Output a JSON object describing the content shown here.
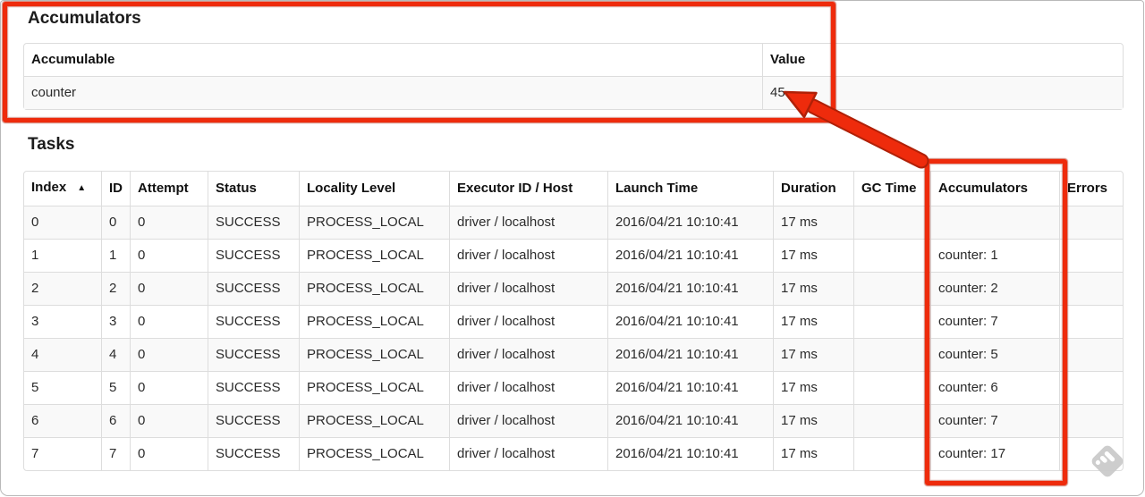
{
  "accumulators_section": {
    "heading": "Accumulators",
    "table": {
      "headers": {
        "accumulable": "Accumulable",
        "value": "Value"
      },
      "rows": [
        {
          "accumulable": "counter",
          "value": "45"
        }
      ]
    }
  },
  "tasks_section": {
    "heading": "Tasks",
    "table": {
      "headers": {
        "index": "Index",
        "id": "ID",
        "attempt": "Attempt",
        "status": "Status",
        "locality": "Locality Level",
        "executor": "Executor ID / Host",
        "launch": "Launch Time",
        "duration": "Duration",
        "gc": "GC Time",
        "accumulators": "Accumulators",
        "errors": "Errors"
      },
      "sort_icon": "▲",
      "rows": [
        {
          "index": "0",
          "id": "0",
          "attempt": "0",
          "status": "SUCCESS",
          "locality": "PROCESS_LOCAL",
          "executor": "driver / localhost",
          "launch": "2016/04/21 10:10:41",
          "duration": "17 ms",
          "gc": "",
          "accumulators": "",
          "errors": ""
        },
        {
          "index": "1",
          "id": "1",
          "attempt": "0",
          "status": "SUCCESS",
          "locality": "PROCESS_LOCAL",
          "executor": "driver / localhost",
          "launch": "2016/04/21 10:10:41",
          "duration": "17 ms",
          "gc": "",
          "accumulators": "counter: 1",
          "errors": ""
        },
        {
          "index": "2",
          "id": "2",
          "attempt": "0",
          "status": "SUCCESS",
          "locality": "PROCESS_LOCAL",
          "executor": "driver / localhost",
          "launch": "2016/04/21 10:10:41",
          "duration": "17 ms",
          "gc": "",
          "accumulators": "counter: 2",
          "errors": ""
        },
        {
          "index": "3",
          "id": "3",
          "attempt": "0",
          "status": "SUCCESS",
          "locality": "PROCESS_LOCAL",
          "executor": "driver / localhost",
          "launch": "2016/04/21 10:10:41",
          "duration": "17 ms",
          "gc": "",
          "accumulators": "counter: 7",
          "errors": ""
        },
        {
          "index": "4",
          "id": "4",
          "attempt": "0",
          "status": "SUCCESS",
          "locality": "PROCESS_LOCAL",
          "executor": "driver / localhost",
          "launch": "2016/04/21 10:10:41",
          "duration": "17 ms",
          "gc": "",
          "accumulators": "counter: 5",
          "errors": ""
        },
        {
          "index": "5",
          "id": "5",
          "attempt": "0",
          "status": "SUCCESS",
          "locality": "PROCESS_LOCAL",
          "executor": "driver / localhost",
          "launch": "2016/04/21 10:10:41",
          "duration": "17 ms",
          "gc": "",
          "accumulators": "counter: 6",
          "errors": ""
        },
        {
          "index": "6",
          "id": "6",
          "attempt": "0",
          "status": "SUCCESS",
          "locality": "PROCESS_LOCAL",
          "executor": "driver / localhost",
          "launch": "2016/04/21 10:10:41",
          "duration": "17 ms",
          "gc": "",
          "accumulators": "counter: 7",
          "errors": ""
        },
        {
          "index": "7",
          "id": "7",
          "attempt": "0",
          "status": "SUCCESS",
          "locality": "PROCESS_LOCAL",
          "executor": "driver / localhost",
          "launch": "2016/04/21 10:10:41",
          "duration": "17 ms",
          "gc": "",
          "accumulators": "counter: 17",
          "errors": ""
        }
      ]
    }
  },
  "annotations": {
    "color": "#ee2b0c",
    "outline_color": "#b02007"
  }
}
